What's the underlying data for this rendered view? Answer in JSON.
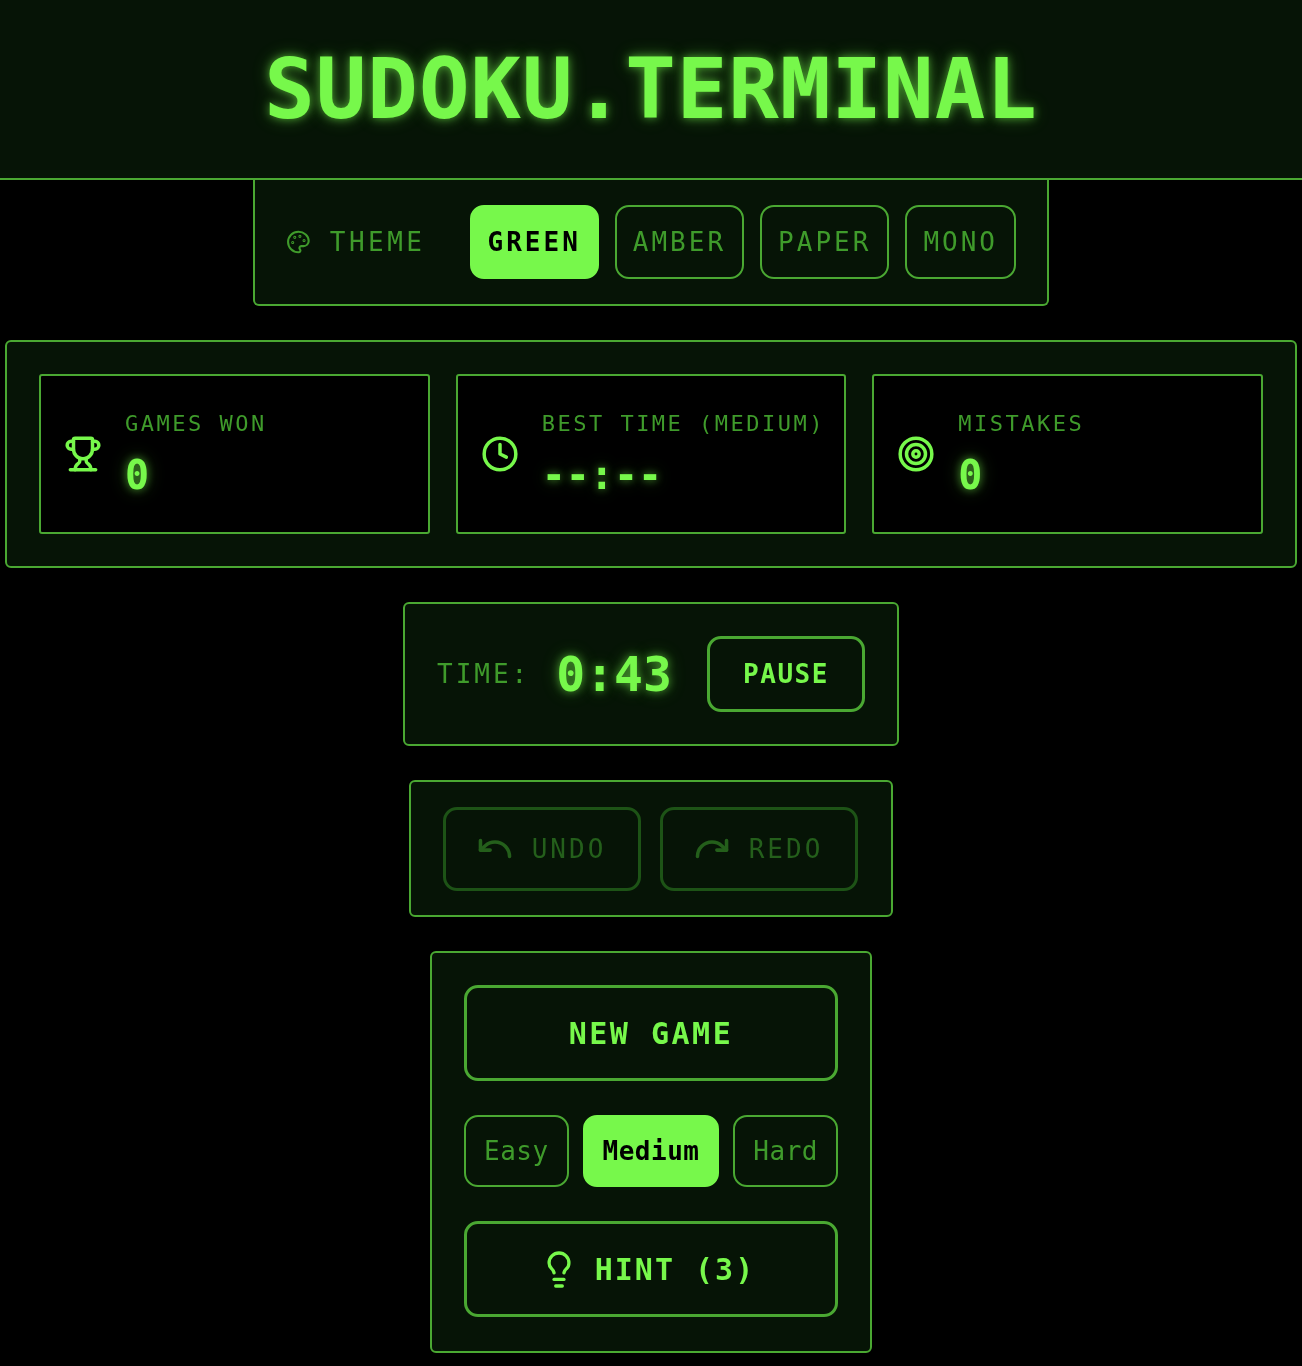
{
  "header": {
    "title": "SUDOKU.TERMINAL"
  },
  "theme_bar": {
    "label": "THEME",
    "options": [
      {
        "label": "GREEN",
        "selected": true
      },
      {
        "label": "AMBER",
        "selected": false
      },
      {
        "label": "PAPER",
        "selected": false
      },
      {
        "label": "MONO",
        "selected": false
      }
    ]
  },
  "stats": [
    {
      "kind": "trophy",
      "label": "GAMES WON",
      "value": "0"
    },
    {
      "kind": "clock",
      "label": "BEST TIME (MEDIUM)",
      "value": "--:--"
    },
    {
      "kind": "target",
      "label": "MISTAKES",
      "value": "0"
    }
  ],
  "timer": {
    "label": "TIME:",
    "value": "0:43",
    "button": "PAUSE"
  },
  "history": [
    {
      "kind": "undo",
      "label": "UNDO",
      "disabled": true
    },
    {
      "kind": "redo",
      "label": "REDO",
      "disabled": true
    }
  ],
  "game": {
    "new_game": "NEW GAME",
    "difficulties": [
      {
        "label": "Easy",
        "selected": false
      },
      {
        "label": "Medium",
        "selected": true
      },
      {
        "label": "Hard",
        "selected": false
      }
    ],
    "hint": "HINT (3)"
  }
}
